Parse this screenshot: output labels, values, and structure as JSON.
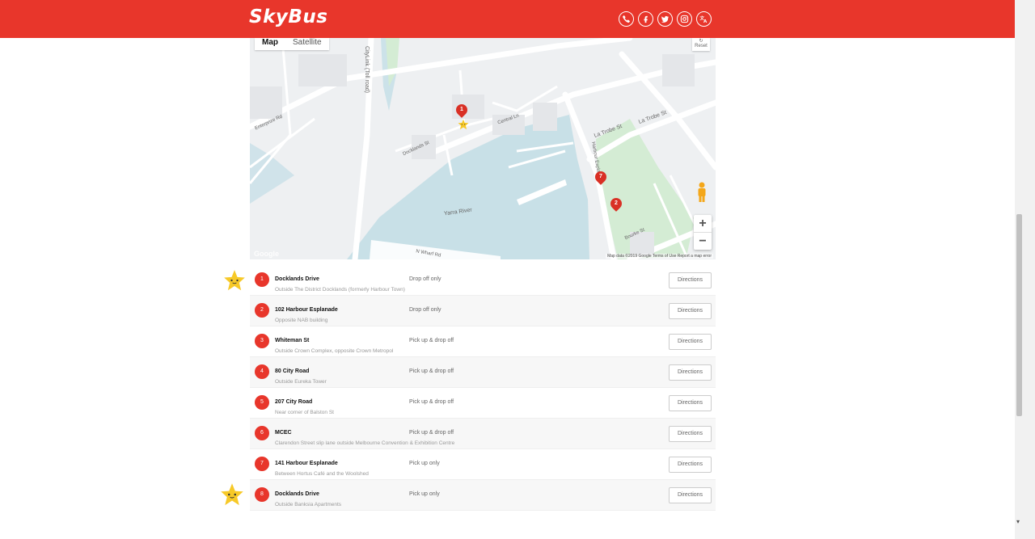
{
  "header": {
    "logo": "SkyBus",
    "social_icons": [
      "phone-icon",
      "facebook-icon",
      "twitter-icon",
      "instagram-icon",
      "translate-icon"
    ],
    "brand_color": "#e8362b"
  },
  "map": {
    "type_map": "Map",
    "type_satellite": "Satellite",
    "reset_label": "Reset",
    "zoom_in": "+",
    "zoom_out": "−",
    "google_label": "Google",
    "attribution": "Map data ©2019 Google   Terms of Use   Report a map error",
    "labels": {
      "citylink": "CityLink (Toll road)",
      "enterprize": "Enterprize Rd",
      "docklands_st": "Docklands St",
      "la_trobe_1": "La Trobe St",
      "la_trobe_2": "La Trobe St",
      "harbour_esp": "Harbour Esplanade",
      "yarra": "Yarra River",
      "bourke": "Bourke St",
      "central_ln": "Central Ln",
      "wharf": "N Wharf Rd"
    },
    "pins": [
      "1",
      "7",
      "2"
    ]
  },
  "stops": [
    {
      "num": "1",
      "name": "Docklands Drive",
      "desc": "Outside The District Docklands (formerly Harbour Town)",
      "type": "Drop off only",
      "button": "Directions",
      "starred": true
    },
    {
      "num": "2",
      "name": "102 Harbour Esplanade",
      "desc": "Opposite NAB building",
      "type": "Drop off only",
      "button": "Directions",
      "starred": false
    },
    {
      "num": "3",
      "name": "Whiteman St",
      "desc": "Outside Crown Complex, opposite Crown Metropol",
      "type": "Pick up & drop off",
      "button": "Directions",
      "starred": false
    },
    {
      "num": "4",
      "name": "80 City Road",
      "desc": "Outside Eureka Tower",
      "type": "Pick up & drop off",
      "button": "Directions",
      "starred": false
    },
    {
      "num": "5",
      "name": "207 City Road",
      "desc": "Near corner of Balston St",
      "type": "Pick up & drop off",
      "button": "Directions",
      "starred": false
    },
    {
      "num": "6",
      "name": "MCEC",
      "desc": "Clarendon Street slip lane outside Melbourne Convention & Exhibition Centre",
      "type": "Pick up & drop off",
      "button": "Directions",
      "starred": false
    },
    {
      "num": "7",
      "name": "141 Harbour Esplanade",
      "desc": "Between Hortus Café and the Woolshed",
      "type": "Pick up only",
      "button": "Directions",
      "starred": false
    },
    {
      "num": "8",
      "name": "Docklands Drive",
      "desc": "Outside Banksia Apartments",
      "type": "Pick up only",
      "button": "Directions",
      "starred": true
    }
  ]
}
